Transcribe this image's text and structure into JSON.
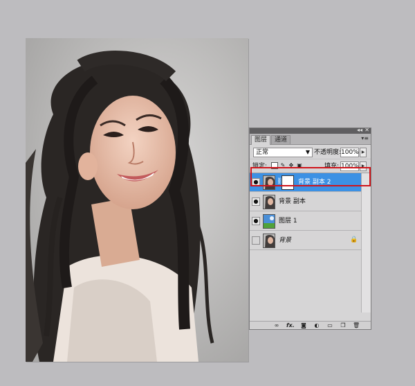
{
  "panel": {
    "topbar_collapse": "◂◂",
    "topbar_close": "✕",
    "tabs": [
      {
        "label": "图层",
        "active": true
      },
      {
        "label": "通道",
        "active": false
      }
    ],
    "menu_icon": "▾≡",
    "blend_mode": "正常",
    "opacity_label": "不透明度:",
    "opacity_value": "100%",
    "lock_label": "锁定:",
    "fill_label": "填充:",
    "fill_value": "100%",
    "layers": [
      {
        "name": "背景 副本 2",
        "selected": true,
        "visible": true,
        "has_mask": true,
        "italic": false,
        "locked": false
      },
      {
        "name": "背景 副本",
        "selected": false,
        "visible": true,
        "has_mask": false,
        "italic": false,
        "locked": false
      },
      {
        "name": "图层 1",
        "selected": false,
        "visible": true,
        "has_mask": false,
        "italic": false,
        "locked": false
      },
      {
        "name": "背景",
        "selected": false,
        "visible": false,
        "has_mask": false,
        "italic": true,
        "locked": true
      }
    ],
    "footer_icons": [
      "link-icon",
      "fx-icon",
      "mask-icon",
      "adjustment-icon",
      "folder-icon",
      "new-layer-icon",
      "trash-icon"
    ],
    "footer_fx": "fx."
  },
  "colors": {
    "selected_layer": "#3c91e4",
    "highlight": "#d0141a",
    "workspace": "#bdbcbf"
  }
}
